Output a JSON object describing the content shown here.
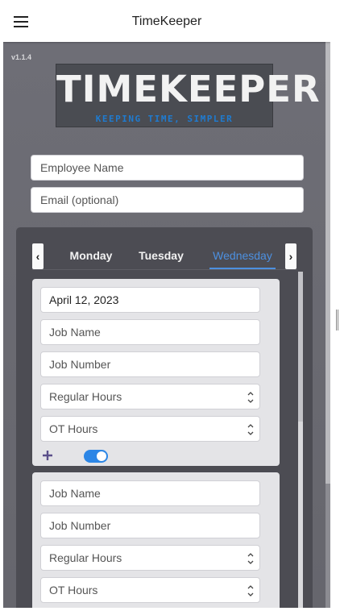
{
  "app": {
    "title": "TimeKeeper",
    "version": "v1.1.4"
  },
  "logo": {
    "main": "TIMEKEEPER",
    "tagline": "KEEPING TIME, SIMPLER"
  },
  "form": {
    "employee_placeholder": "Employee Name",
    "email_placeholder": "Email (optional)"
  },
  "tabs": {
    "items": [
      "Monday",
      "Tuesday",
      "Wednesday"
    ],
    "active": "Wednesday",
    "prev_arrow": "‹",
    "next_arrow": "›"
  },
  "entries": [
    {
      "date": "April 12, 2023",
      "job_name": "Job Name",
      "job_number": "Job Number",
      "regular_hours": "Regular Hours",
      "ot_hours": "OT Hours",
      "toggle_on": true
    },
    {
      "job_name": "Job Name",
      "job_number": "Job Number",
      "regular_hours": "Regular Hours",
      "ot_hours": "OT Hours"
    }
  ],
  "colors": {
    "accent": "#4d90e0",
    "toggle": "#2c86e6",
    "plus_icon": "#5a4f8a"
  },
  "icons": [
    "hamburger-menu-icon",
    "chevron-left-icon",
    "chevron-right-icon",
    "plus-icon",
    "toggle-switch"
  ]
}
